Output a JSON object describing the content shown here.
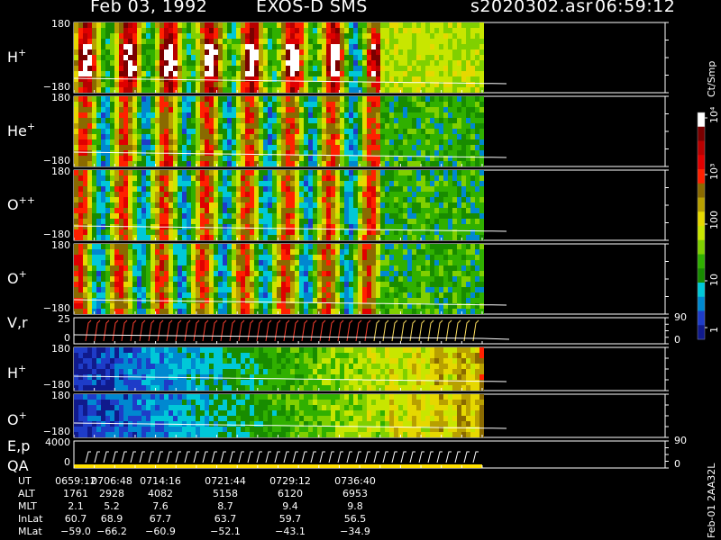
{
  "header": {
    "date": "Feb 03, 1992",
    "instrument": "EXOS-D SMS",
    "file": "s2020302.asr",
    "time": "06:59:12"
  },
  "colorbar": {
    "title": "Ct/Smp",
    "ticks": [
      "10⁴",
      "10³",
      "100",
      "10",
      "1"
    ],
    "colors": [
      "#ffffff",
      "#7a0000",
      "#b80000",
      "#e00000",
      "#ff2000",
      "#8a6a00",
      "#b8a000",
      "#e6d800",
      "#c8e600",
      "#80d000",
      "#30b000",
      "#188c00",
      "#00c8d8",
      "#0088d0",
      "#1e3cc8",
      "#101a8c"
    ],
    "log_range": [
      0,
      4
    ]
  },
  "panels": [
    {
      "label": "H",
      "sup": "+",
      "ymax": "180",
      "ymin": "−180"
    },
    {
      "label": "He",
      "sup": "+",
      "ymax": "180",
      "ymin": "−180"
    },
    {
      "label": "O",
      "sup": "++",
      "ymax": "180",
      "ymin": "−180"
    },
    {
      "label": "O",
      "sup": "+",
      "ymax": "180",
      "ymin": "−180"
    },
    {
      "label": "V,r",
      "sup": "",
      "ymax": "25",
      "ymin": "0",
      "rmax": "90",
      "rmin": "0"
    },
    {
      "label": "H",
      "sup": "+",
      "ymax": "180",
      "ymin": "−180"
    },
    {
      "label": "O",
      "sup": "+",
      "ymax": "180",
      "ymin": "−180"
    },
    {
      "label": "E,p",
      "sup": "",
      "ymax": "4000",
      "ymin": "0",
      "rmax": "90",
      "rmin": "0"
    }
  ],
  "qa_label": "QA",
  "ephemeris": {
    "rows": [
      {
        "name": "UT",
        "values": [
          "0659:12",
          "0706:48",
          "0714:16",
          "0721:44",
          "0729:12",
          "0736:40"
        ]
      },
      {
        "name": "ALT",
        "values": [
          "1761",
          "2928",
          "4082",
          "5158",
          "6120",
          "6953"
        ]
      },
      {
        "name": "MLT",
        "values": [
          "2.1",
          "5.2",
          "7.6",
          "8.7",
          "9.4",
          "9.8"
        ]
      },
      {
        "name": "InLat",
        "values": [
          "60.7",
          "68.9",
          "67.7",
          "63.7",
          "59.7",
          "56.5"
        ]
      },
      {
        "name": "MLat",
        "values": [
          "−59.0",
          "−66.2",
          "−60.9",
          "−52.1",
          "−43.1",
          "−34.9"
        ]
      }
    ]
  },
  "footer_id": "Feb-01 2AA32L",
  "chart_data": {
    "type": "heatmap",
    "title": "Feb 03, 1992 EXOS-D SMS s2020302.asr 06:59:12",
    "x": [
      "0659:12",
      "0706:48",
      "0714:16",
      "0721:44",
      "0729:12",
      "0736:40"
    ],
    "series": [
      {
        "name": "H+",
        "ylim": [
          -180,
          180
        ]
      },
      {
        "name": "He+",
        "ylim": [
          -180,
          180
        ]
      },
      {
        "name": "O++",
        "ylim": [
          -180,
          180
        ]
      },
      {
        "name": "O+",
        "ylim": [
          -180,
          180
        ]
      },
      {
        "name": "V,r",
        "ylim": [
          0,
          25
        ],
        "right_ylim": [
          0,
          90
        ]
      },
      {
        "name": "H+",
        "ylim": [
          -180,
          180
        ]
      },
      {
        "name": "O+",
        "ylim": [
          -180,
          180
        ]
      },
      {
        "name": "E,p",
        "ylim": [
          0,
          4000
        ],
        "right_ylim": [
          0,
          90
        ]
      }
    ],
    "colorbar_range_log10": [
      0,
      4
    ]
  }
}
